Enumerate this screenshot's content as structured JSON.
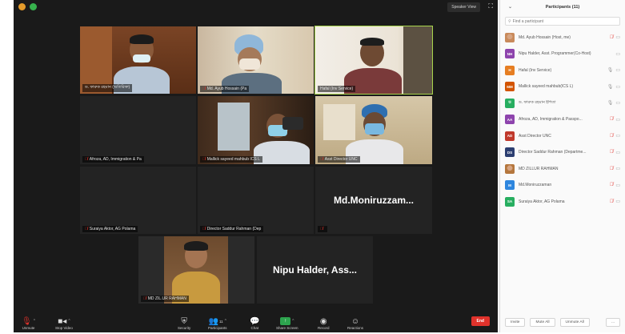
{
  "top_bar": {
    "speaker_view_label": "Speaker View"
  },
  "tiles": [
    {
      "name": "ড. ফারুক রহমান (অতিরিক্ত)",
      "muted": false
    },
    {
      "name": "Md. Ayub Hossain (Pa",
      "muted": true
    },
    {
      "name": "Hafal (Inv Service)",
      "muted": false
    },
    {
      "name": "Afroza, AD, Immigration & Pa",
      "muted": true
    },
    {
      "name": "Mallick sayeed mahbub ICS L",
      "muted": true
    },
    {
      "name": "Asst Director UNC",
      "muted": true
    },
    {
      "name": "Suraiya Aktor, AG Polama",
      "muted": true
    },
    {
      "name": "Director Saddur Rahman (Dep",
      "muted": true
    },
    {
      "name": "",
      "muted": true,
      "big_name": "Md.Moniruzzam..."
    },
    {
      "name": "MD ZIL.UR RAHMAN",
      "muted": true
    },
    {
      "name": "",
      "muted": false,
      "big_name": "Nipu Halder, Ass..."
    }
  ],
  "toolbar": {
    "unmute": "Unmute",
    "stop_video": "Stop Video",
    "security": "Security",
    "participants": "Participants",
    "participants_count": "11",
    "chat": "Chat",
    "share_screen": "Share Screen",
    "record": "Record",
    "reactions": "Reactions",
    "end": "End"
  },
  "participants_panel": {
    "title": "Participants (11)",
    "search_placeholder": "Find a participant",
    "participants": [
      {
        "name": "Md. Ayub Hossain (Host, me)",
        "initials": "",
        "avatar_color": "#c98a5b",
        "photo": true,
        "mic": "off"
      },
      {
        "name": "Nipu Halder, Asst. Programmer(Co-Host)",
        "initials": "NH",
        "avatar_color": "#8e44ad",
        "photo": false,
        "mic": "none"
      },
      {
        "name": "Hafal (Inv Service)",
        "initials": "H",
        "avatar_color": "#e67e22",
        "photo": false,
        "mic": "on"
      },
      {
        "name": "Mallick sayeed mahbub(ICS L)",
        "initials": "MM",
        "avatar_color": "#d35400",
        "photo": false,
        "mic": "on"
      },
      {
        "name": "ড. ফারুক রহমান ইশিতা",
        "initials": "ড",
        "avatar_color": "#27ae60",
        "photo": false,
        "mic": "on"
      },
      {
        "name": "Afroza, AD, Immigration & Passpo...",
        "initials": "AA",
        "avatar_color": "#8e44ad",
        "photo": false,
        "mic": "off"
      },
      {
        "name": "Asst Director UNC",
        "initials": "AD",
        "avatar_color": "#c0392b",
        "photo": false,
        "mic": "off"
      },
      {
        "name": "Director Saddur Rahman (Departme...",
        "initials": "DS",
        "avatar_color": "#2c3e70",
        "photo": false,
        "mic": "off"
      },
      {
        "name": "MD ZILLUR RAHMAN",
        "initials": "",
        "avatar_color": "#b5773d",
        "photo": true,
        "mic": "off"
      },
      {
        "name": "Md.Moniruzzaman",
        "initials": "M",
        "avatar_color": "#2e86de",
        "photo": false,
        "mic": "off"
      },
      {
        "name": "Suraiya Aktor, AG Polama",
        "initials": "SA",
        "avatar_color": "#27ae60",
        "photo": false,
        "mic": "off"
      }
    ],
    "footer": {
      "invite": "Invite",
      "mute_all": "Mute All",
      "unmute_all": "Unmute All",
      "more": "..."
    }
  }
}
